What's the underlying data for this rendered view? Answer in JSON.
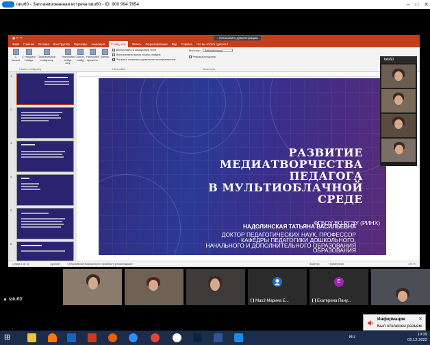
{
  "window": {
    "title": "tatu60 - Запланированная встреча tatu60 - ID: 900 994 7954"
  },
  "ppt": {
    "stop_demo": "Остановить демонстрацию",
    "tabs": [
      "Файл",
      "Главная",
      "Вставка",
      "Конструктор",
      "Переходы",
      "Анимация",
      "Слайд-шоу",
      "Запись",
      "Рецензирование",
      "Вид",
      "Справка",
      "Что вы хотите сделать?"
    ],
    "active_tab": "Слайд-шоу",
    "ribbon": {
      "btn1": "С начала",
      "btn2": "С текущего слайда",
      "btn3": "Произвольный слайд-шоу",
      "group1": "Начать слайд-шоу",
      "btn4": "Настройка слайд-шоу",
      "btn5": "Скрыть слайд",
      "btn6": "Настройка времени",
      "btn7": "Запись",
      "chk1": "Воспроизвести закадровый текст",
      "chk2": "Использовать время показа слайдов",
      "chk3": "Показать элементы управления проигрывателем",
      "group2": "Настройка",
      "monitor_label": "Монитор:",
      "monitor_value": "Автоматически",
      "presenter": "Режим докладчика",
      "group3": "Мониторы"
    },
    "slide": {
      "title_lines": [
        "РАЗВИТИЕ",
        "МЕДИАТВОРЧЕСТВА",
        "ПЕДАГОГА",
        "В МУЛЬТИОБЛАЧНОЙ СРЕДЕ"
      ],
      "author": "НАДОЛИНСКАЯ ТАТЬЯНА ВАСИЛЬЕВНА",
      "lines": [
        "ДОКТОР ПЕДАГОГИЧЕСКИХ НАУК, ПРОФЕССОР",
        "КАФЕДРЫ ПЕДАГОГИКИ ДОШКОЛЬНОГО,",
        "НАЧАЛЬНОГО И ДОПОЛНИТЕЛЬНОГО ОБРАЗОВАНИЯ",
        "ОБРАЗОВАНИЯ",
        "ФГБОУ ВО РГЭУ (РИНХ)"
      ]
    },
    "thumb_numbers": [
      "1",
      "2",
      "3",
      "4",
      "5",
      "6"
    ],
    "status": {
      "slide": "Слайд 1 из 11",
      "lang": "русский",
      "access": "Специальные возможности: проверьте рекомендации",
      "notes": "Заметки",
      "comments": "Примечания",
      "zoom": "174 %"
    }
  },
  "video_panel": {
    "header": "tatu60"
  },
  "participants": [
    {
      "name": ""
    },
    {
      "name": ""
    },
    {
      "name": ""
    },
    {
      "name": "Мах3 Марина Е...",
      "initial": ""
    },
    {
      "name": "Екатерина Пану...",
      "initial": "Е"
    },
    {
      "name": ""
    }
  ],
  "self_label": "tatu60",
  "notification": {
    "title": "Информация",
    "body": "Был отключен разъем."
  },
  "tray": {
    "lang": "RU",
    "time": "10:39",
    "date": "02.12.2022"
  }
}
